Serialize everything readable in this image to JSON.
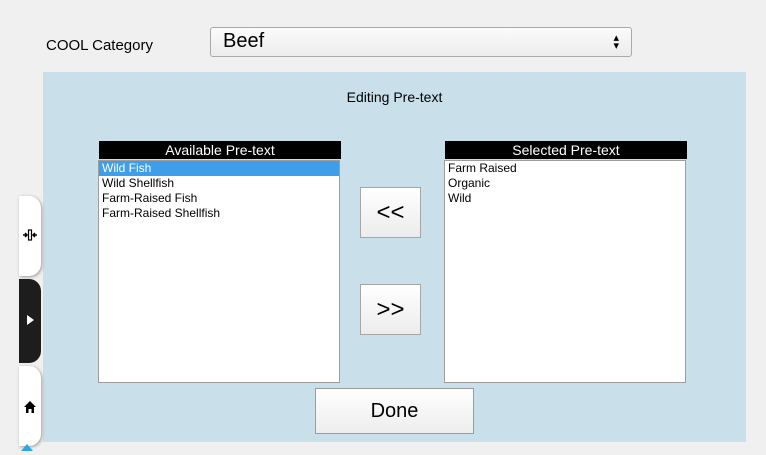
{
  "header": {
    "cool_label": "COOL Category",
    "cool_value": "Beef"
  },
  "panel": {
    "title": "Editing Pre-text",
    "available": {
      "header": "Available Pre-text",
      "items": [
        "Wild Fish",
        "Wild Shellfish",
        "Farm-Raised Fish",
        "Farm-Raised Shellfish"
      ],
      "selected_index": 0
    },
    "selected": {
      "header": "Selected Pre-text",
      "items": [
        "Farm Raised",
        "Organic",
        "Wild"
      ]
    },
    "move_left_label": "<<",
    "move_right_label": ">>",
    "done_label": "Done"
  },
  "colors": {
    "panel_bg": "#c9dfea",
    "selection": "#3e9eea",
    "accent": "#2aa7e6"
  },
  "dock": {
    "icons": [
      "fit-icon",
      "play-icon",
      "home-icon"
    ]
  }
}
